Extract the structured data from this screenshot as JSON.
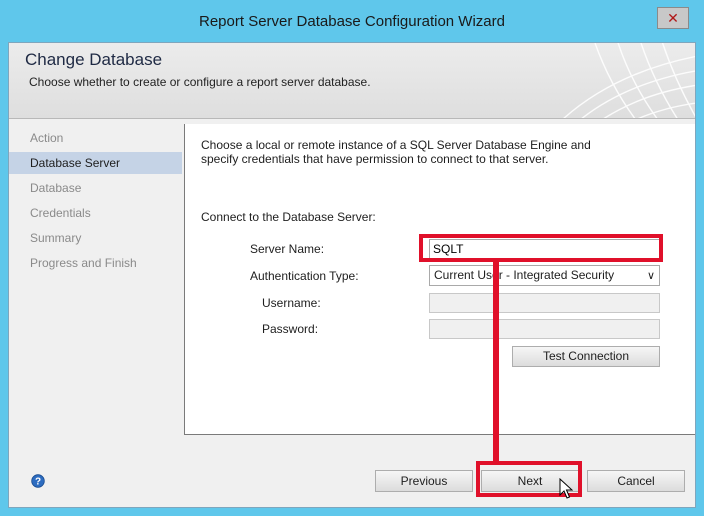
{
  "window": {
    "title": "Report Server Database Configuration Wizard",
    "close_glyph": "✕"
  },
  "header": {
    "title": "Change Database",
    "subtitle": "Choose whether to create or configure a report server database."
  },
  "nav": {
    "items": [
      {
        "label": "Action",
        "active": false
      },
      {
        "label": "Database Server",
        "active": true
      },
      {
        "label": "Database",
        "active": false
      },
      {
        "label": "Credentials",
        "active": false
      },
      {
        "label": "Summary",
        "active": false
      },
      {
        "label": "Progress and Finish",
        "active": false
      }
    ]
  },
  "content": {
    "intro": "Choose a local or remote instance of a SQL Server Database Engine and specify credentials that have permission to connect to that server.",
    "section_label": "Connect to the Database Server:",
    "server_name_label": "Server Name:",
    "server_name_value": "SQLT",
    "auth_type_label": "Authentication Type:",
    "auth_type_value": "Current User - Integrated Security",
    "username_label": "Username:",
    "username_value": "",
    "password_label": "Password:",
    "password_value": "",
    "test_connection_label": "Test Connection"
  },
  "footer": {
    "previous_label": "Previous",
    "next_label": "Next",
    "cancel_label": "Cancel",
    "help_glyph": "?"
  },
  "colors": {
    "frame": "#5fc7eb",
    "highlight": "#e0102a",
    "nav_active": "#c5d3e6",
    "help_icon": "#2d6cc0"
  }
}
